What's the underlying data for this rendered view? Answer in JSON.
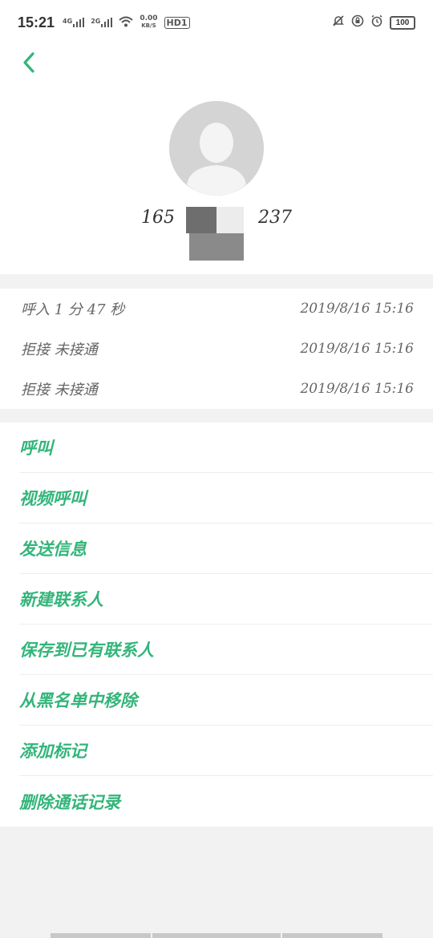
{
  "status_bar": {
    "time": "15:21",
    "net1": "4G",
    "net2": "2G",
    "speed": "0.00",
    "speed_unit": "KB/S",
    "hd": "HD1",
    "battery": "100"
  },
  "contact": {
    "number_left": "165",
    "number_right": "237"
  },
  "call_log": [
    {
      "type": "呼入  1 分 47 秒",
      "time": "2019/8/16  15:16"
    },
    {
      "type": "拒接  未接通",
      "time": "2019/8/16  15:16"
    },
    {
      "type": "拒接  未接通",
      "time": "2019/8/16  15:16"
    }
  ],
  "actions": [
    {
      "label": "呼叫"
    },
    {
      "label": "视频呼叫"
    },
    {
      "label": "发送信息"
    },
    {
      "label": "新建联系人"
    },
    {
      "label": "保存到已有联系人"
    },
    {
      "label": "从黑名单中移除"
    },
    {
      "label": "添加标记"
    },
    {
      "label": "删除通话记录"
    }
  ],
  "colors": {
    "accent": "#33b57a",
    "background": "#f2f2f2"
  }
}
